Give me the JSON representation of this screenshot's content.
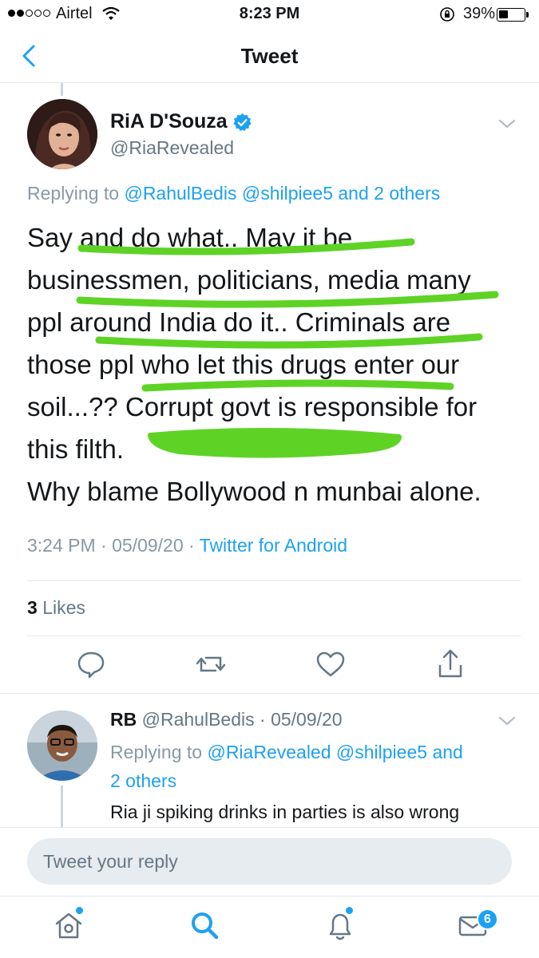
{
  "status_bar": {
    "carrier": "Airtel",
    "time": "8:23 PM",
    "battery_percent": "39%",
    "battery_level": 0.39,
    "signal_bars_filled": 2,
    "signal_bars_total": 5
  },
  "nav": {
    "title": "Tweet",
    "back_icon": "chevron-left-icon"
  },
  "tweet": {
    "author_name": "RiA D'Souza",
    "author_handle": "@RiaRevealed",
    "verified": true,
    "replying_to_prefix": "Replying to",
    "replying_to_users": [
      "@RahulBedis",
      "@shilpiee5"
    ],
    "replying_to_others": "and 2 others",
    "text_lines": [
      "Say and do what.. May it be",
      "businessmen, politicians, media many",
      "ppl around India do it.. Criminals are",
      "those ppl who let this drugs enter our",
      "soil...?? Corrupt govt is responsible for",
      "this filth.",
      "Why blame Bollywood n munbai alone."
    ],
    "time": "3:24 PM",
    "date": "05/09/20",
    "source": "Twitter for Android",
    "likes_count": "3",
    "likes_label": "Likes",
    "highlight_color": "#5ed326"
  },
  "reply": {
    "author_name": "RB",
    "author_handle": "@RahulBedis",
    "date": "05/09/20",
    "replying_to_prefix": "Replying to",
    "replying_to_users": [
      "@RiaRevealed",
      "@shilpiee5"
    ],
    "replying_to_others_line1": "and",
    "replying_to_others_line2": "2 others",
    "text": "Ria ji spiking drinks in parties is also wrong"
  },
  "composer": {
    "placeholder": "Tweet your reply"
  },
  "tab_bar": {
    "items": [
      "home-icon",
      "search-icon",
      "notifications-icon",
      "messages-icon"
    ],
    "messages_badge": "6"
  },
  "colors": {
    "link": "#1da1f2",
    "muted": "#657786",
    "light_muted": "#8899a6",
    "divider": "#e1e8ed"
  }
}
